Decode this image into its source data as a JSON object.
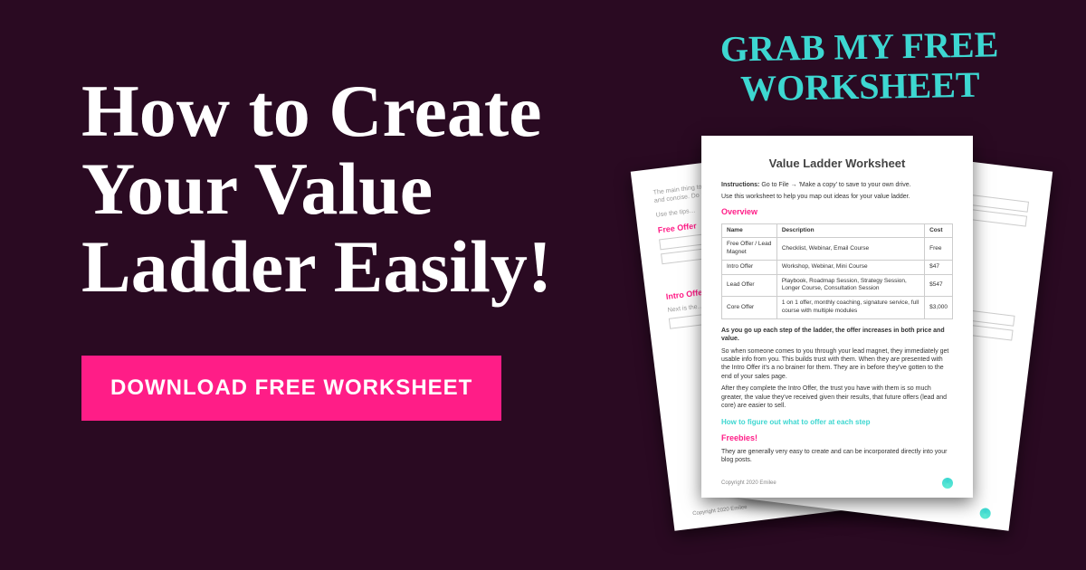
{
  "headline": "How to Create Your Value Ladder Easily!",
  "cta_label": "DOWNLOAD FREE WORKSHEET",
  "handwritten": "GRAB MY FREE WORKSHEET",
  "worksheet": {
    "title": "Value Ladder Worksheet",
    "instructions_label": "Instructions:",
    "instructions": "Go to File → 'Make a copy' to save to your own drive.",
    "intro": "Use this worksheet to help you map out ideas for your value ladder.",
    "overview_heading": "Overview",
    "table": {
      "headers": [
        "Name",
        "Description",
        "Cost"
      ],
      "rows": [
        [
          "Free Offer / Lead Magnet",
          "Checklist, Webinar, Email Course",
          "Free"
        ],
        [
          "Intro Offer",
          "Workshop, Webinar, Mini Course",
          "$47"
        ],
        [
          "Lead Offer",
          "Playbook, Roadmap Session, Strategy Session, Longer Course, Consultation Session",
          "$547"
        ],
        [
          "Core Offer",
          "1 on 1 offer, monthly coaching, signature service, full course with multiple modules",
          "$3,000"
        ]
      ]
    },
    "body_bold": "As you go up each step of the ladder, the offer increases in both price and value.",
    "body1": "So when someone comes to you through your lead magnet, they immediately get usable info from you. This builds trust with them. When they are presented with the Intro Offer it's a no brainer for them. They are in before they've gotten to the end of your sales page.",
    "body2": "After they complete the Intro Offer, the trust you have with them is so much greater, the value they've received given their results, that future offers (lead and core) are easier to sell.",
    "section_heading": "How to figure out what to offer at each step",
    "freebies_heading": "Freebies!",
    "freebies_text": "They are generally very easy to create and can be incorporated directly into your blog posts.",
    "copyright": "Copyright 2020 Emilee",
    "back": {
      "free_offer_heading": "Free Offer",
      "intro_offer_heading": "Intro Offer",
      "p1": "The main thing to remember about freebies is that they should be result driven and concise. Do not fluff it.",
      "p2": "Use the tips…"
    }
  }
}
